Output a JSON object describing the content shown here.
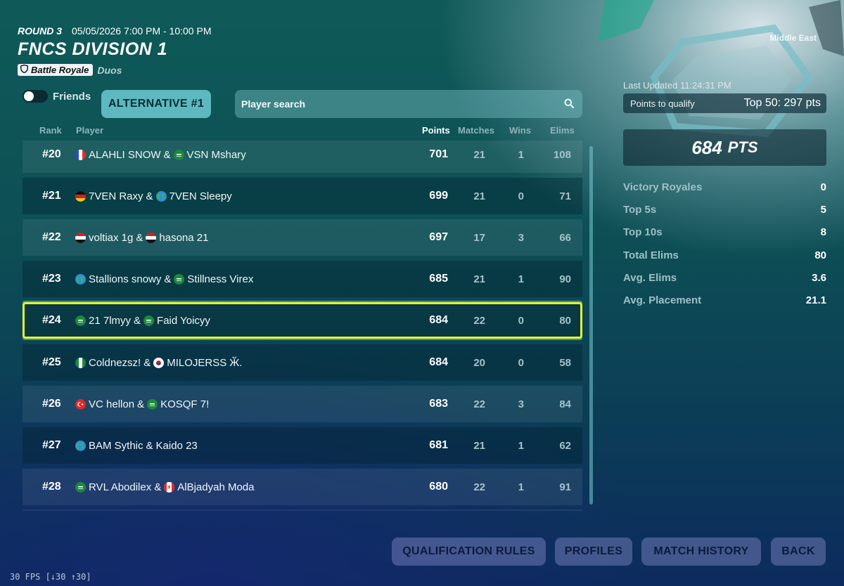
{
  "header": {
    "round": "ROUND 3",
    "time": "05/05/2026 7:00 PM - 10:00 PM",
    "title": "FNCS DIVISION 1",
    "mode": "Battle Royale",
    "mode_sub": "Duos"
  },
  "controls": {
    "friends_label": "Friends",
    "alternative_label": "ALTERNATIVE #1",
    "search_placeholder": "Player search"
  },
  "columns": {
    "rank": "Rank",
    "player": "Player",
    "points": "Points",
    "matches": "Matches",
    "wins": "Wins",
    "elims": "Elims"
  },
  "rows": [
    {
      "rank": "#20",
      "p1": "ALAHLI SNOW",
      "f1": "fr",
      "sep": "&",
      "p2": "VSN Mshary",
      "f2": "sa",
      "points": "701",
      "matches": "21",
      "wins": "1",
      "elims": "108"
    },
    {
      "rank": "#21",
      "p1": "7VEN Raxy",
      "f1": "de",
      "sep": "&",
      "p2": "7VEN Sleepy",
      "f2": "globe",
      "points": "699",
      "matches": "21",
      "wins": "0",
      "elims": "71"
    },
    {
      "rank": "#22",
      "p1": "voltiax 1g",
      "f1": "eg",
      "sep": "&",
      "p2": "hasona 21",
      "f2": "eg",
      "points": "697",
      "matches": "17",
      "wins": "3",
      "elims": "66"
    },
    {
      "rank": "#23",
      "p1": "Stallions snowy",
      "f1": "globe",
      "sep": "&",
      "p2": "Stillness Virex",
      "f2": "sa",
      "points": "685",
      "matches": "21",
      "wins": "1",
      "elims": "90"
    },
    {
      "rank": "#24",
      "p1": "21 7lmyy",
      "f1": "sa",
      "sep": "&",
      "p2": "Faid Yoicyy",
      "f2": "sa",
      "points": "684",
      "matches": "22",
      "wins": "0",
      "elims": "80"
    },
    {
      "rank": "#25",
      "p1": "Coldnezsz!",
      "f1": "ng",
      "sep": "&",
      "p2": "MILOJERSS Ӂ.",
      "f2": "kr",
      "points": "684",
      "matches": "20",
      "wins": "0",
      "elims": "58"
    },
    {
      "rank": "#26",
      "p1": "VC hellon",
      "f1": "tr",
      "sep": "&",
      "p2": "KOSQF 7!",
      "f2": "sa",
      "points": "683",
      "matches": "22",
      "wins": "3",
      "elims": "84"
    },
    {
      "rank": "#27",
      "p1": "BAM Sythic",
      "f1": "globe",
      "sep": "&",
      "p2": "Kaido 23",
      "f2": "",
      "points": "681",
      "matches": "21",
      "wins": "1",
      "elims": "62"
    },
    {
      "rank": "#28",
      "p1": "RVL Abodilex",
      "f1": "sa",
      "sep": "&",
      "p2": "AlBjadyah Moda",
      "f2": "ca",
      "points": "680",
      "matches": "22",
      "wins": "1",
      "elims": "91"
    }
  ],
  "selected_rank": "#24",
  "panel": {
    "region": "Middle East",
    "last_updated": "Last Updated 11:24:31 PM",
    "qualify_label": "Points to qualify",
    "qualify_value": "Top 50: 297 pts",
    "points_big": "684",
    "points_unit": "PTS",
    "stats": [
      {
        "label": "Victory Royales",
        "value": "0"
      },
      {
        "label": "Top 5s",
        "value": "5"
      },
      {
        "label": "Top 10s",
        "value": "8"
      },
      {
        "label": "Total Elims",
        "value": "80"
      },
      {
        "label": "Avg. Elims",
        "value": "3.6"
      },
      {
        "label": "Avg. Placement",
        "value": "21.1"
      }
    ]
  },
  "buttons": {
    "qualification_rules": "QUALIFICATION RULES",
    "profiles": "PROFILES",
    "match_history": "MATCH HISTORY",
    "back": "BACK"
  },
  "fps": "30 FPS [↓30 ↑30]",
  "colors": {
    "accent_teal": "#5eb8bf",
    "selected_outline": "#e2f52b",
    "button_bg": "#7f8cc8"
  }
}
